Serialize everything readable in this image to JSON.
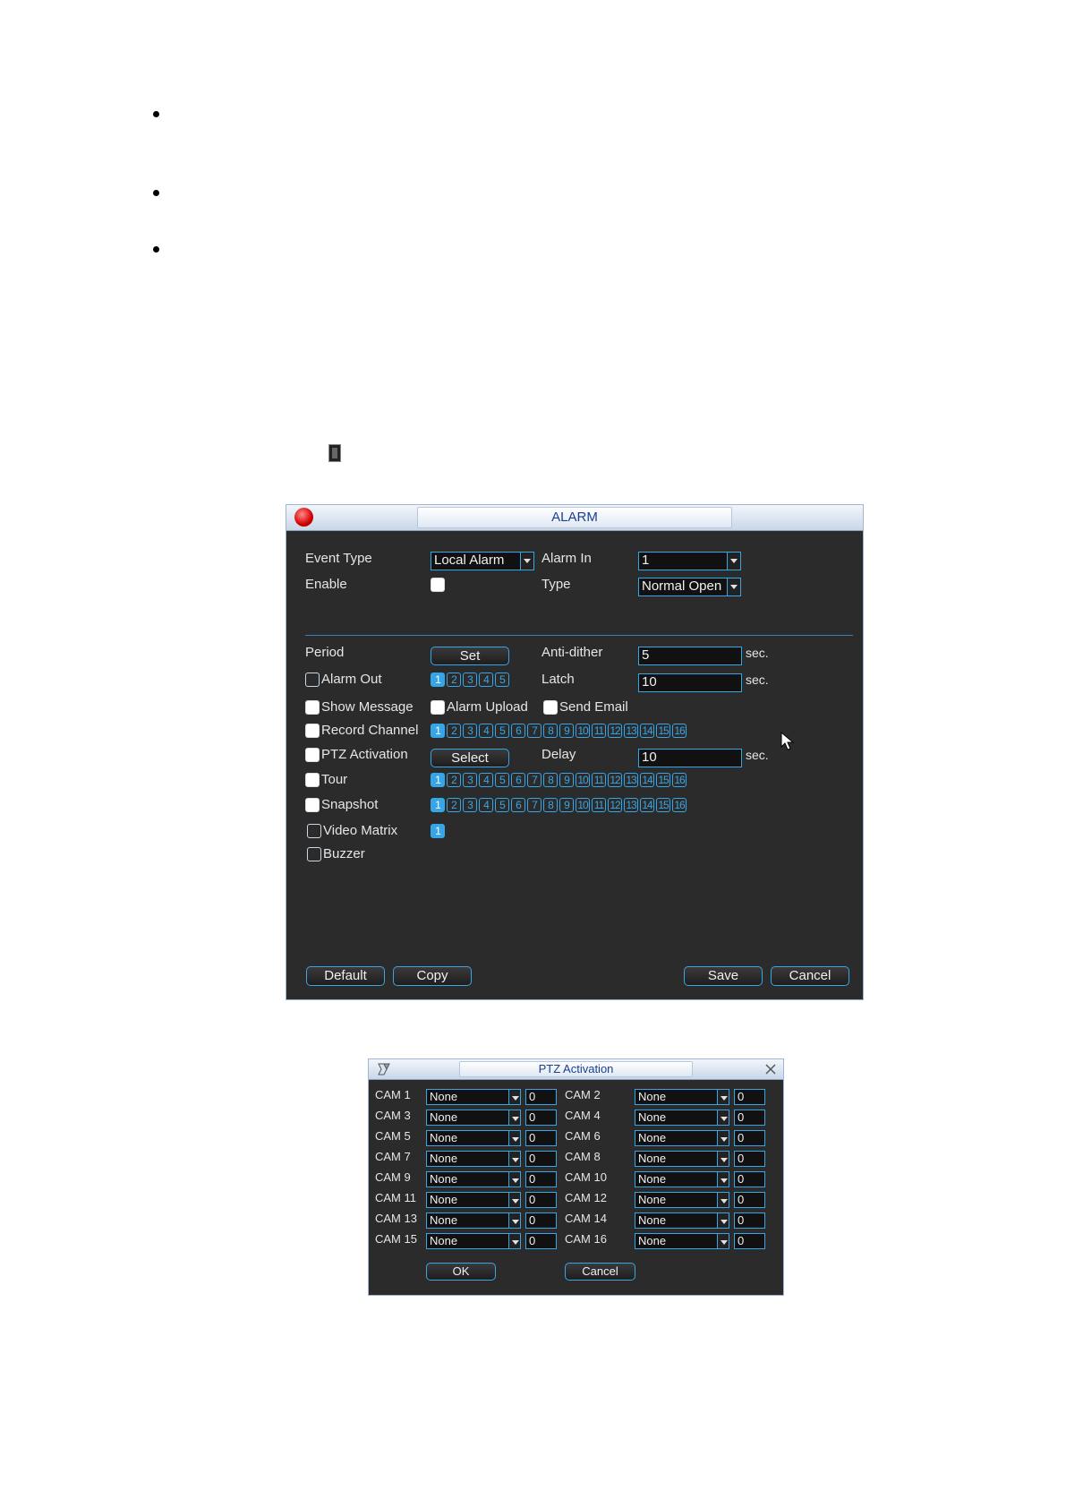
{
  "alarm": {
    "title": "ALARM",
    "event_type_label": "Event Type",
    "event_type_value": "Local Alarm",
    "alarm_in_label": "Alarm In",
    "alarm_in_value": "1",
    "enable_label": "Enable",
    "type_label": "Type",
    "type_value": "Normal Open",
    "period_label": "Period",
    "set_button": "Set",
    "anti_dither_label": "Anti-dither",
    "anti_dither_value": "5",
    "sec_unit": "sec.",
    "alarm_out_label": "Alarm Out",
    "alarm_out_channels": [
      "1",
      "2",
      "3",
      "4",
      "5"
    ],
    "latch_label": "Latch",
    "latch_value": "10",
    "show_message_label": "Show Message",
    "alarm_upload_label": "Alarm Upload",
    "send_email_label": "Send Email",
    "record_channel_label": "Record Channel",
    "channels16": [
      "1",
      "2",
      "3",
      "4",
      "5",
      "6",
      "7",
      "8",
      "9",
      "10",
      "11",
      "12",
      "13",
      "14",
      "15",
      "16"
    ],
    "ptz_activation_label": "PTZ Activation",
    "select_button": "Select",
    "delay_label": "Delay",
    "delay_value": "10",
    "tour_label": "Tour",
    "snapshot_label": "Snapshot",
    "video_matrix_label": "Video Matrix",
    "video_matrix_channels": [
      "1"
    ],
    "buzzer_label": "Buzzer",
    "default_button": "Default",
    "copy_button": "Copy",
    "save_button": "Save",
    "cancel_button": "Cancel"
  },
  "ptz": {
    "title": "PTZ Activation",
    "rows": [
      {
        "left_cam": "CAM 1",
        "left_value": "None",
        "left_num": "0",
        "right_cam": "CAM 2",
        "right_value": "None",
        "right_num": "0"
      },
      {
        "left_cam": "CAM 3",
        "left_value": "None",
        "left_num": "0",
        "right_cam": "CAM 4",
        "right_value": "None",
        "right_num": "0"
      },
      {
        "left_cam": "CAM 5",
        "left_value": "None",
        "left_num": "0",
        "right_cam": "CAM 6",
        "right_value": "None",
        "right_num": "0"
      },
      {
        "left_cam": "CAM 7",
        "left_value": "None",
        "left_num": "0",
        "right_cam": "CAM 8",
        "right_value": "None",
        "right_num": "0"
      },
      {
        "left_cam": "CAM 9",
        "left_value": "None",
        "left_num": "0",
        "right_cam": "CAM 10",
        "right_value": "None",
        "right_num": "0"
      },
      {
        "left_cam": "CAM 11",
        "left_value": "None",
        "left_num": "0",
        "right_cam": "CAM 12",
        "right_value": "None",
        "right_num": "0"
      },
      {
        "left_cam": "CAM 13",
        "left_value": "None",
        "left_num": "0",
        "right_cam": "CAM 14",
        "right_value": "None",
        "right_num": "0"
      },
      {
        "left_cam": "CAM 15",
        "left_value": "None",
        "left_num": "0",
        "right_cam": "CAM 16",
        "right_value": "None",
        "right_num": "0"
      }
    ],
    "ok_button": "OK",
    "cancel_button": "Cancel"
  }
}
